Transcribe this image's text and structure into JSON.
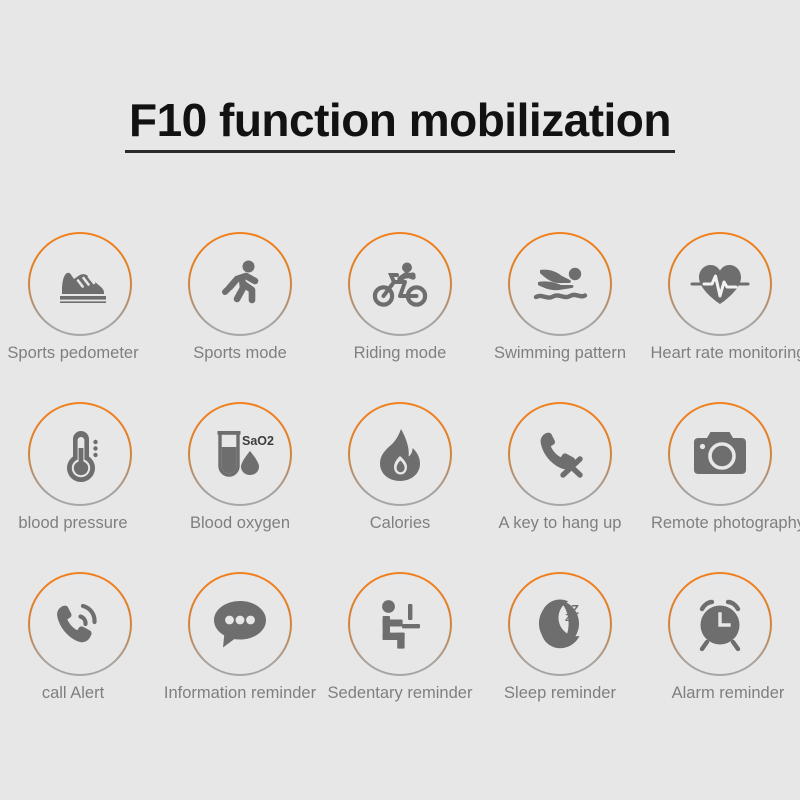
{
  "page": {
    "background_color": "#e7e7e7",
    "title": "F10 function mobilization",
    "ring_color_top": "#f08220",
    "ring_color_bottom": "#a8a8a8",
    "icon_color": "#6e6e6e",
    "label_color": "#7f7f7f",
    "title_color": "#121212"
  },
  "features": [
    {
      "icon": "running-shoe-icon",
      "label": "Sports pedometer"
    },
    {
      "icon": "running-person-icon",
      "label": "Sports mode"
    },
    {
      "icon": "bicycle-rider-icon",
      "label": "Riding mode"
    },
    {
      "icon": "swimmer-icon",
      "label": "Swimming pattern"
    },
    {
      "icon": "heart-pulse-icon",
      "label": "Heart rate monitoring"
    },
    {
      "icon": "thermometer-icon",
      "label": "blood pressure"
    },
    {
      "icon": "test-tube-icon",
      "label": "Blood oxygen",
      "badge": "SaO2"
    },
    {
      "icon": "flame-icon",
      "label": "Calories"
    },
    {
      "icon": "phone-hangup-icon",
      "label": "A key to hang up"
    },
    {
      "icon": "camera-icon",
      "label": "Remote photography"
    },
    {
      "icon": "phone-ringing-icon",
      "label": "call  Alert"
    },
    {
      "icon": "speech-bubble-icon",
      "label": "Information reminder"
    },
    {
      "icon": "sitting-person-icon",
      "label": "Sedentary reminder"
    },
    {
      "icon": "moon-sleep-icon",
      "label": "Sleep reminder"
    },
    {
      "icon": "alarm-clock-icon",
      "label": "Alarm reminder"
    }
  ]
}
